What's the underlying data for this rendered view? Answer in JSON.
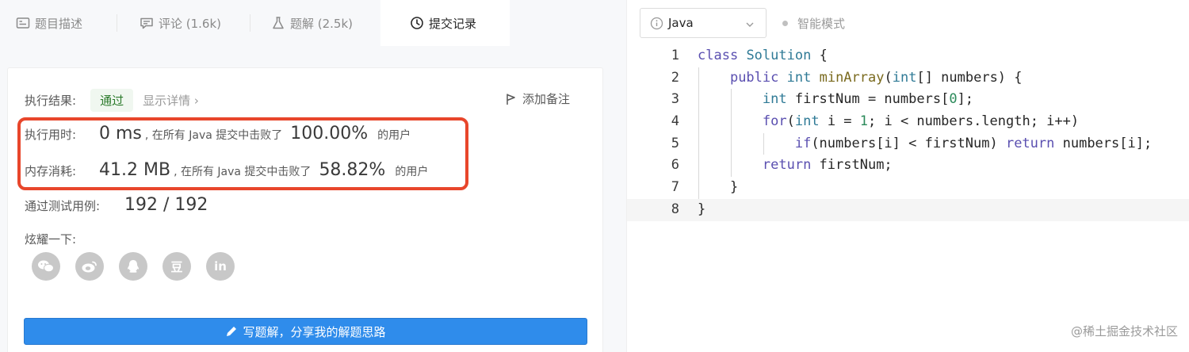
{
  "tabs": [
    {
      "label": "题目描述",
      "icon": "description-icon"
    },
    {
      "label": "评论 (1.6k)",
      "icon": "comment-icon"
    },
    {
      "label": "题解 (2.5k)",
      "icon": "flask-icon"
    },
    {
      "label": "提交记录",
      "icon": "clock-icon"
    }
  ],
  "result": {
    "label": "执行结果:",
    "status": "通过",
    "detail_link": "显示详情 ›",
    "add_note": "添加备注"
  },
  "runtime": {
    "label": "执行用时:",
    "value": "0 ms",
    "beat_text": ", 在所有 Java 提交中击败了",
    "percent": "100.00%",
    "suffix": "的用户"
  },
  "memory": {
    "label": "内存消耗:",
    "value": "41.2 MB",
    "beat_text": ", 在所有 Java 提交中击败了",
    "percent": "58.82%",
    "suffix": "的用户"
  },
  "tests": {
    "label": "通过测试用例:",
    "value": "192 / 192"
  },
  "share": {
    "title": "炫耀一下:",
    "icons": [
      "wechat-icon",
      "weibo-icon",
      "qq-icon",
      "douban-icon",
      "linkedin-icon"
    ],
    "douban_glyph": "豆",
    "linkedin_glyph": "in"
  },
  "write_button": "写题解，分享我的解题思路",
  "editor": {
    "language": "Java",
    "smart_mode": "智能模式"
  },
  "code": {
    "line_numbers": [
      "1",
      "2",
      "3",
      "4",
      "5",
      "6",
      "7",
      "8"
    ],
    "lines": [
      "class Solution {",
      "    public int minArray(int[] numbers) {",
      "        int firstNum = numbers[0];",
      "        for(int i = 1; i < numbers.length; i++)",
      "            if(numbers[i] < firstNum) return numbers[i];",
      "        return firstNum;",
      "    }",
      "}"
    ]
  },
  "watermark": "@稀土掘金技术社区",
  "colors": {
    "accent": "#2f8ceb",
    "highlight_border": "#e8462b",
    "pass_text": "#2b7a2b"
  }
}
